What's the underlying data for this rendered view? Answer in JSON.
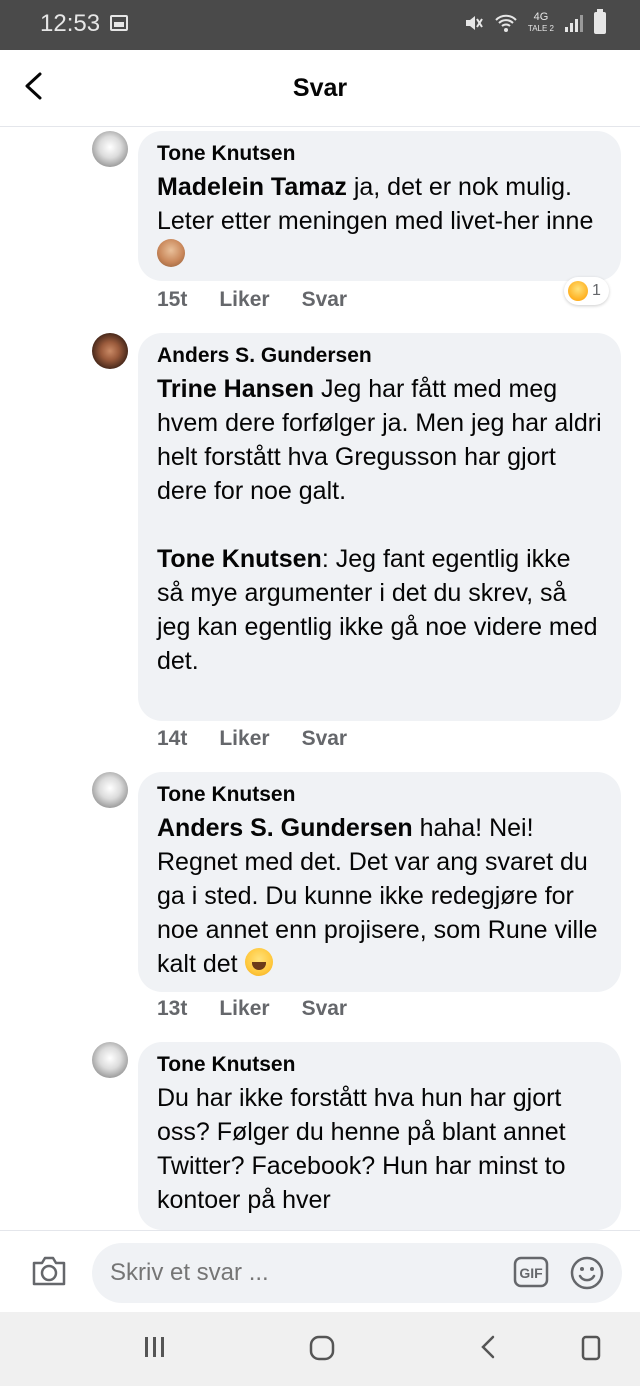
{
  "status_bar": {
    "time": "12:53",
    "network": "4G",
    "network_sub": "TALE 2"
  },
  "header": {
    "title": "Svar"
  },
  "comments": [
    {
      "author": "Tone Knutsen",
      "mention": "Madelein Tamaz",
      "text": " ja, det er nok mulig. Leter etter meningen med livet-her inne ",
      "emoji": "see-no-evil-monkey",
      "time": "15t",
      "like_label": "Liker",
      "reply_label": "Svar",
      "reaction_count": "1",
      "reaction_icon": "laughing-face-icon"
    },
    {
      "author": "Anders S. Gundersen",
      "mention": "Trine Hansen",
      "text": " Jeg har fått med meg hvem dere forfølger ja. Men jeg har aldri helt forstått hva Gregusson har gjort dere for noe galt.",
      "mention2": "Tone Knutsen",
      "text2": ": Jeg fant egentlig ikke så mye argumenter i det du skrev, så jeg kan egentlig ikke gå noe videre med det.",
      "time": "14t",
      "like_label": "Liker",
      "reply_label": "Svar"
    },
    {
      "author": "Tone Knutsen",
      "mention": "Anders S. Gundersen",
      "text": " haha! Nei! Regnet med det. Det var ang svaret du ga i sted. Du kunne ikke redegjøre for noe annet enn projisere, som Rune ville kalt det ",
      "emoji": "grinning-squinting-face",
      "time": "13t",
      "like_label": "Liker",
      "reply_label": "Svar"
    },
    {
      "author": "Tone Knutsen",
      "text": "Du har ikke forstått hva hun har gjort oss? Følger du henne på blant annet Twitter? Facebook? Hun har minst to kontoer på hver"
    }
  ],
  "composer": {
    "placeholder": "Skriv et svar ...",
    "gif_label": "GIF"
  },
  "colors": {
    "bubble": "#f0f2f5",
    "meta_text": "#65676b",
    "status_bar": "#4a4a4a"
  }
}
